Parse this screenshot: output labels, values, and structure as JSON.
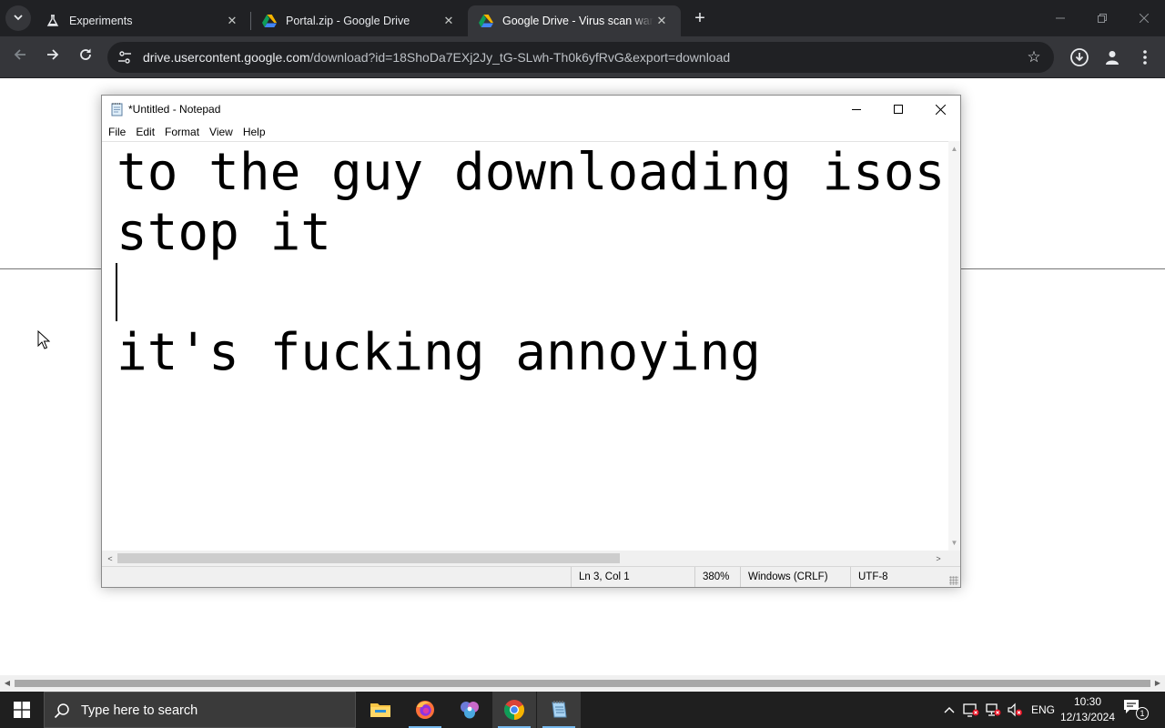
{
  "browser": {
    "tabs": [
      {
        "title": "Experiments",
        "favicon": "flask-icon",
        "close": "✕"
      },
      {
        "title": "Portal.zip - Google Drive",
        "favicon": "google-drive-icon",
        "close": "✕"
      },
      {
        "title": "Google Drive - Virus scan warning",
        "favicon": "google-drive-icon",
        "close": "✕"
      }
    ],
    "new_tab_label": "+",
    "address": {
      "domain": "drive.usercontent.google.com",
      "path": "/download?id=18ShoDa7EXj2Jy_tG-SLwh-Th0k6yfRvG&export=download"
    },
    "icons": [
      "back-icon",
      "forward-icon",
      "reload-icon",
      "site-info-icon",
      "bookmark-star-icon",
      "downloads-icon",
      "profile-icon",
      "menu-icon"
    ]
  },
  "notepad": {
    "title": "*Untitled - Notepad",
    "menu": [
      "File",
      "Edit",
      "Format",
      "View",
      "Help"
    ],
    "lines": [
      "to the guy downloading isos",
      "stop it",
      "",
      "it's fucking annoying"
    ],
    "status": {
      "position": "Ln 3, Col 1",
      "zoom": "380%",
      "line_ending": "Windows (CRLF)",
      "encoding": "UTF-8"
    }
  },
  "taskbar": {
    "search_placeholder": "Type here to search",
    "apps": [
      "file-explorer-icon",
      "firefox-icon",
      "games-app-icon",
      "chrome-icon",
      "notepad-icon"
    ],
    "language": "ENG",
    "time": "10:30",
    "date": "12/13/2024",
    "notification_count": "1"
  },
  "colors": {
    "chrome_frame": "#202124",
    "chrome_toolbar": "#35363a",
    "taskbar": "#1f1f1f",
    "taskbar_running_indicator": "#76b9ed",
    "drive_green": "#0f9d58",
    "drive_yellow": "#f4b400",
    "drive_blue": "#4285f4"
  }
}
